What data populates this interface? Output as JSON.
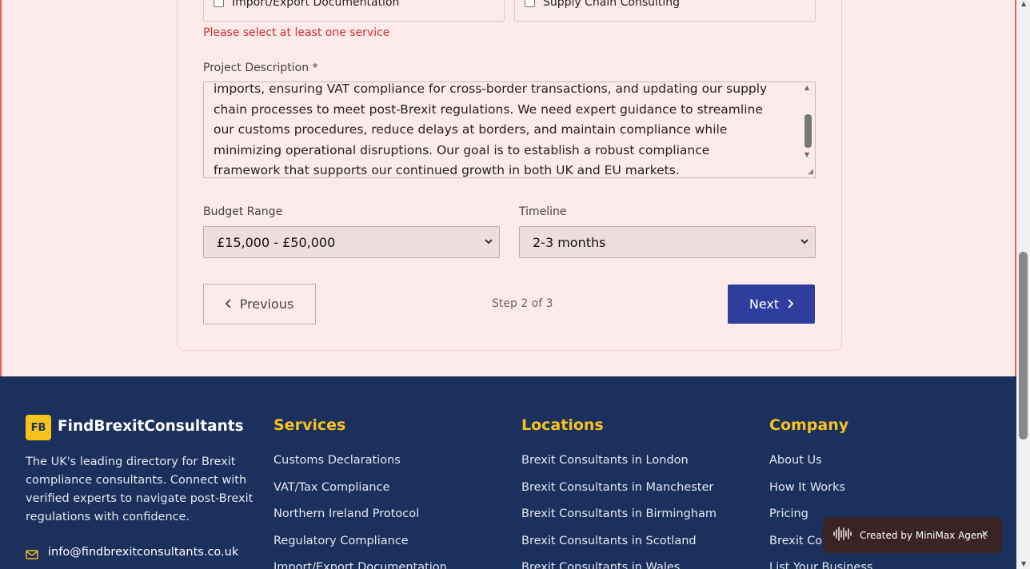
{
  "services": {
    "left_label": "Import/Export Documentation",
    "right_label": "Supply Chain Consulting",
    "error": "Please select at least one service"
  },
  "description": {
    "label": "Project Description *",
    "lines": [
      "imports, ensuring VAT compliance for cross-border transactions, and updating our supply",
      "chain processes to meet post-Brexit regulations. We need expert guidance to streamline",
      "our customs procedures, reduce delays at borders, and maintain compliance while",
      "minimizing operational disruptions. Our goal is to establish a robust compliance",
      "framework that supports our continued growth in both UK and EU markets."
    ]
  },
  "budget": {
    "label": "Budget Range",
    "value": "£15,000 - £50,000"
  },
  "timeline": {
    "label": "Timeline",
    "value": "2-3 months"
  },
  "nav": {
    "prev": "Previous",
    "next": "Next",
    "step": "Step 2 of 3"
  },
  "footer": {
    "logo_badge": "FB",
    "brand": "FindBrexitConsultants",
    "description": "The UK's leading directory for Brexit compliance consultants. Connect with verified experts to navigate post-Brexit regulations with confidence.",
    "email": "info@findbrexitconsultants.co.uk",
    "services": {
      "heading": "Services",
      "links": [
        "Customs Declarations",
        "VAT/Tax Compliance",
        "Northern Ireland Protocol",
        "Regulatory Compliance",
        "Import/Export Documentation"
      ]
    },
    "locations": {
      "heading": "Locations",
      "links": [
        "Brexit Consultants in London",
        "Brexit Consultants in Manchester",
        "Brexit Consultants in Birmingham",
        "Brexit Consultants in Scotland",
        "Brexit Consultants in Wales"
      ]
    },
    "company": {
      "heading": "Company",
      "links": [
        "About Us",
        "How It Works",
        "Pricing",
        "Brexit Con",
        "List Your Business"
      ]
    }
  },
  "toast": {
    "text": "Created by MiniMax Agent",
    "close": "×"
  },
  "colors": {
    "primary": "#2f3d9e",
    "footer_bg": "#1b305d",
    "accent": "#f7c21a",
    "error": "#d32f2f"
  }
}
